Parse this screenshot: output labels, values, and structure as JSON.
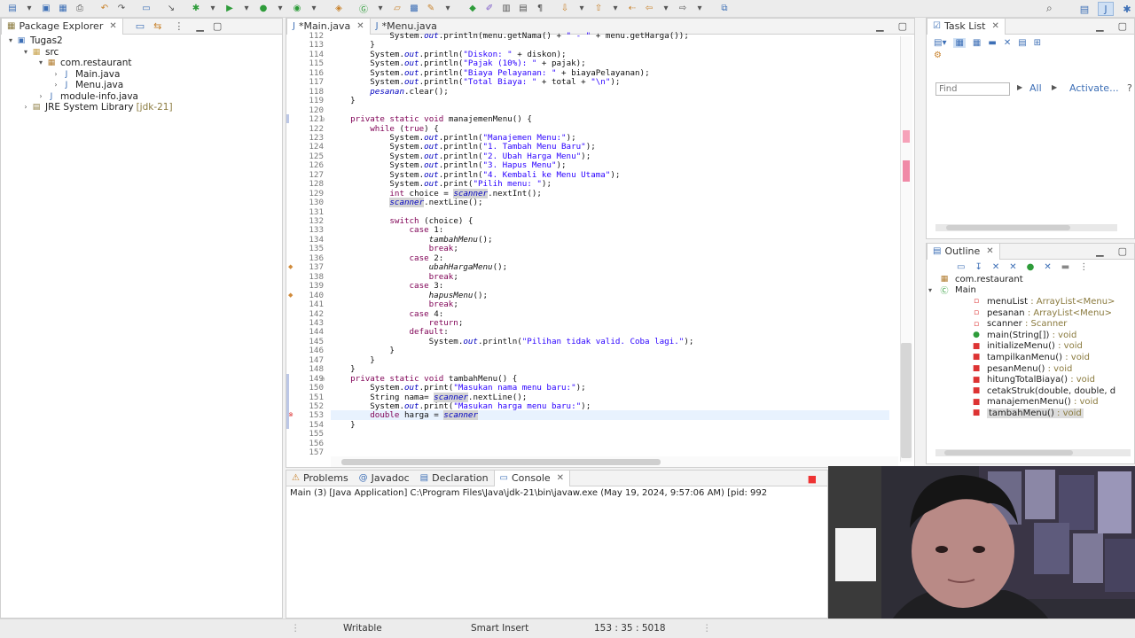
{
  "toolbar": {
    "search_icon": "search-icon"
  },
  "package_explorer": {
    "title": "Package Explorer",
    "tree": [
      {
        "label": "Tugas2",
        "depth": 0,
        "icon": "project-icon",
        "expanded": true
      },
      {
        "label": "src",
        "depth": 1,
        "icon": "source-folder-icon",
        "expanded": true
      },
      {
        "label": "com.restaurant",
        "depth": 2,
        "icon": "package-icon",
        "expanded": true
      },
      {
        "label": "Main.java",
        "depth": 3,
        "icon": "java-file-icon",
        "expanded": false
      },
      {
        "label": "Menu.java",
        "depth": 3,
        "icon": "java-file-icon",
        "expanded": false
      },
      {
        "label": "module-info.java",
        "depth": 2,
        "icon": "java-file-icon",
        "expanded": false
      },
      {
        "label": "JRE System Library",
        "decoration": "[jdk-21]",
        "depth": 1,
        "icon": "library-icon",
        "expanded": false
      }
    ]
  },
  "editor": {
    "tabs": [
      {
        "label": "*Main.java",
        "active": true
      },
      {
        "label": "*Menu.java",
        "active": false
      }
    ],
    "line_numbers": [
      "112",
      "113",
      "114",
      "115",
      "116",
      "117",
      "118",
      "119",
      "120",
      "121",
      "122",
      "123",
      "124",
      "125",
      "126",
      "127",
      "128",
      "129",
      "130",
      "131",
      "132",
      "133",
      "134",
      "135",
      "136",
      "137",
      "138",
      "139",
      "140",
      "141",
      "142",
      "143",
      "144",
      "145",
      "146",
      "147",
      "148",
      "149",
      "150",
      "151",
      "152",
      "153",
      "154",
      "155",
      "156",
      "157"
    ],
    "code": [
      "            System.out.println(menu.getNama() + \" - \" + menu.getHarga());",
      "        }",
      "        System.out.println(\"Diskon: \" + diskon);",
      "        System.out.println(\"Pajak (10%): \" + pajak);",
      "        System.out.println(\"Biaya Pelayanan: \" + biayaPelayanan);",
      "        System.out.println(\"Total Biaya: \" + total + \"\\n\");",
      "        pesanan.clear();",
      "    }",
      "",
      "    private static void manajemenMenu() {",
      "        while (true) {",
      "            System.out.println(\"Manajemen Menu:\");",
      "            System.out.println(\"1. Tambah Menu Baru\");",
      "            System.out.println(\"2. Ubah Harga Menu\");",
      "            System.out.println(\"3. Hapus Menu\");",
      "            System.out.println(\"4. Kembali ke Menu Utama\");",
      "            System.out.print(\"Pilih menu: \");",
      "            int choice = scanner.nextInt();",
      "            scanner.nextLine();",
      "",
      "            switch (choice) {",
      "                case 1:",
      "                    tambahMenu();",
      "                    break;",
      "                case 2:",
      "                    ubahHargaMenu();",
      "                    break;",
      "                case 3:",
      "                    hapusMenu();",
      "                    break;",
      "                case 4:",
      "                    return;",
      "                default:",
      "                    System.out.println(\"Pilihan tidak valid. Coba lagi.\");",
      "            }",
      "        }",
      "    }",
      "    private static void tambahMenu() {",
      "        System.out.print(\"Masukan nama menu baru:\");",
      "        String nama= scanner.nextLine();",
      "        System.out.print(\"Masukan harga menu baru:\");",
      "        double harga = scanner",
      "    }",
      "",
      "",
      ""
    ]
  },
  "task_list": {
    "title": "Task List",
    "find_placeholder": "Find",
    "all_label": "All",
    "activate_label": "Activate..."
  },
  "outline": {
    "title": "Outline",
    "items": [
      {
        "name": "com.restaurant",
        "type": "",
        "depth": 0,
        "icon": "package-icon"
      },
      {
        "name": "Main",
        "type": "",
        "depth": 0,
        "icon": "class-icon"
      },
      {
        "name": "menuList",
        "type": " : ArrayList<Menu>",
        "depth": 1,
        "icon": "field-private-icon"
      },
      {
        "name": "pesanan",
        "type": " : ArrayList<Menu>",
        "depth": 1,
        "icon": "field-private-icon"
      },
      {
        "name": "scanner",
        "type": " : Scanner",
        "depth": 1,
        "icon": "field-private-icon"
      },
      {
        "name": "main(String[])",
        "type": " : void",
        "depth": 1,
        "icon": "method-public-icon"
      },
      {
        "name": "initializeMenu()",
        "type": " : void",
        "depth": 1,
        "icon": "method-private-icon"
      },
      {
        "name": "tampilkanMenu()",
        "type": " : void",
        "depth": 1,
        "icon": "method-private-icon"
      },
      {
        "name": "pesanMenu()",
        "type": " : void",
        "depth": 1,
        "icon": "method-private-icon"
      },
      {
        "name": "hitungTotalBiaya()",
        "type": " : void",
        "depth": 1,
        "icon": "method-private-icon"
      },
      {
        "name": "cetakStruk(double, double, d",
        "type": "",
        "depth": 1,
        "icon": "method-private-icon"
      },
      {
        "name": "manajemenMenu()",
        "type": " : void",
        "depth": 1,
        "icon": "method-private-icon"
      },
      {
        "name": "tambahMenu()",
        "type": " : void",
        "depth": 1,
        "icon": "method-private-icon",
        "selected": true
      }
    ]
  },
  "console": {
    "tabs": [
      {
        "label": "Problems",
        "icon": "problems-icon"
      },
      {
        "label": "Javadoc",
        "icon": "javadoc-icon"
      },
      {
        "label": "Declaration",
        "icon": "declaration-icon"
      },
      {
        "label": "Console",
        "icon": "console-icon",
        "active": true
      }
    ],
    "launch_line": "Main (3) [Java Application] C:\\Program Files\\Java\\jdk-21\\bin\\javaw.exe  (May 19, 2024, 9:57:06 AM) [pid: 992"
  },
  "status_bar": {
    "writable": "Writable",
    "insert_mode": "Smart Insert",
    "position": "153 : 35 : 5018"
  },
  "colors": {
    "keyword": "#7f0055",
    "string": "#2a00ff",
    "field": "#0000c0",
    "selection": "#cfe0f4"
  }
}
